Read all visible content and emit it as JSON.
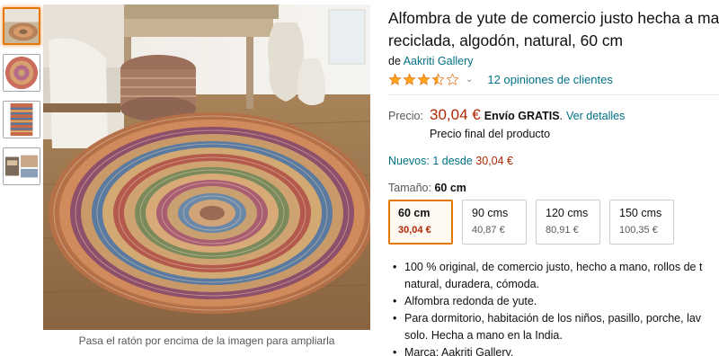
{
  "thumbnails": [
    {
      "icon": "rug-room-thumb",
      "active": true
    },
    {
      "icon": "rug-round-thumb",
      "active": false
    },
    {
      "icon": "rug-texture-thumb",
      "active": false
    },
    {
      "icon": "rug-detail-thumb",
      "active": false
    }
  ],
  "zoom_hint": "Pasa el ratón por encima de la imagen para ampliarla",
  "product": {
    "title": "Alfombra de yute de comercio justo hecha a mano",
    "title_line2": "reciclada, algodón, natural, 60 cm",
    "by_prefix": "de",
    "brand": "Aakriti Gallery",
    "rating": 3.5,
    "reviews_label": "12 opiniones de clientes"
  },
  "price": {
    "label": "Precio:",
    "value": "30,04 €",
    "shipping": "Envío GRATIS",
    "details_link": "Ver detalles",
    "final_note": "Precio final del producto"
  },
  "new_offers": {
    "label": "Nuevos: 1 desde",
    "price": "30,04 €"
  },
  "size": {
    "label": "Tamaño:",
    "selected": "60 cm",
    "options": [
      {
        "size": "60 cm",
        "price": "30,04 €",
        "selected": true
      },
      {
        "size": "90 cms",
        "price": "40,87 €",
        "selected": false
      },
      {
        "size": "120 cms",
        "price": "80,91 €",
        "selected": false
      },
      {
        "size": "150 cms",
        "price": "100,35 €",
        "selected": false
      }
    ]
  },
  "bullets": [
    "100 % original, de comercio justo, hecho a mano, rollos de t",
    "natural, duradera, cómoda.",
    "Alfombra redonda de yute.",
    "Para dormitorio, habitación de los niños, pasillo, porche, lav",
    "solo. Hecha a mano en la India.",
    "Marca: Aakriti Gallery."
  ],
  "colors": {
    "link": "#007185",
    "price": "#b12704",
    "star": "#ffa41c",
    "selected_border": "#e77600"
  }
}
